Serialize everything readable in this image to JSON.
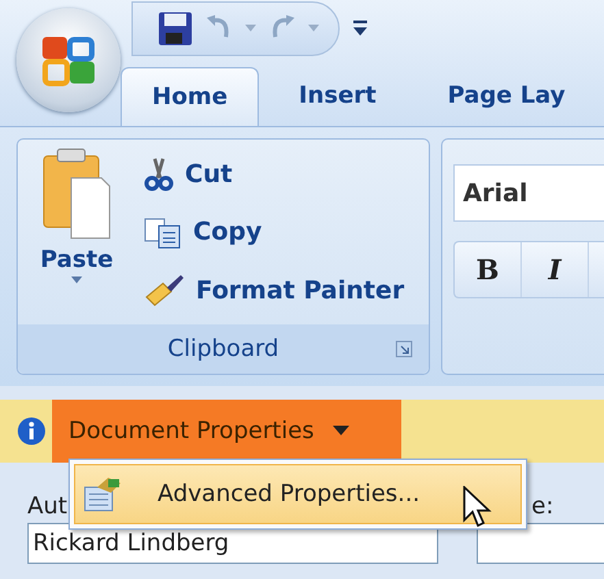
{
  "tabs": [
    {
      "label": "Home",
      "selected": true
    },
    {
      "label": "Insert",
      "selected": false
    },
    {
      "label": "Page Lay",
      "selected": false
    }
  ],
  "clipboard": {
    "paste": "Paste",
    "title": "Clipboard",
    "commands": [
      {
        "kind": "cut",
        "label": "Cut"
      },
      {
        "kind": "copy",
        "label": "Copy"
      },
      {
        "kind": "painter",
        "label": "Format Painter"
      }
    ]
  },
  "font": {
    "name": "Arial",
    "buttons": [
      {
        "kind": "bold",
        "label": "B"
      },
      {
        "kind": "italic",
        "label": "I"
      }
    ]
  },
  "properties": {
    "title": "Document Properties",
    "expanded": true,
    "menu": [
      {
        "label": "Advanced Properties...",
        "selected": true
      }
    ]
  },
  "form": {
    "fields": [
      {
        "label": "Aut",
        "value": "Rickard Lindberg"
      },
      {
        "label": "e:"
      }
    ]
  }
}
